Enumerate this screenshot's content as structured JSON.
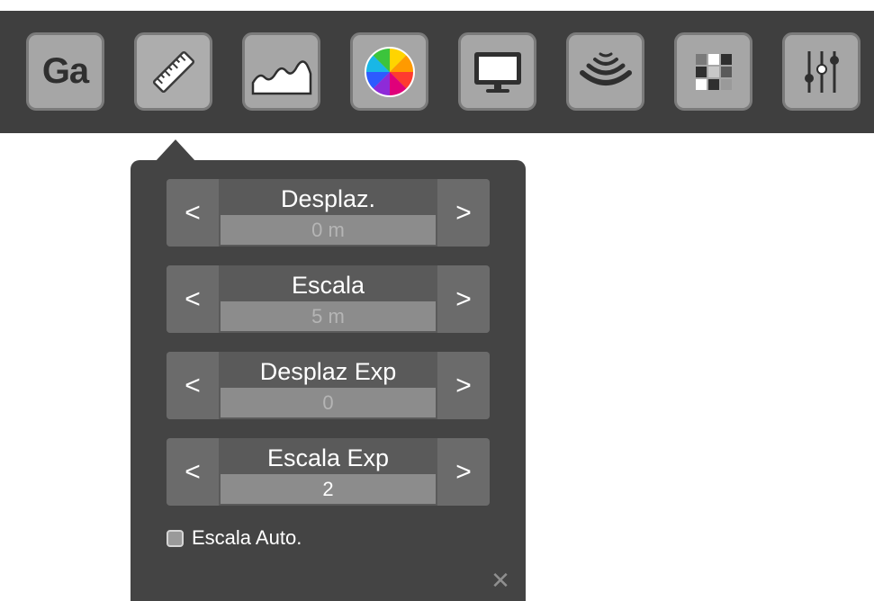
{
  "toolbar": {
    "buttons": [
      {
        "id": "gain",
        "icon": "gain-text-icon",
        "text": "Ga"
      },
      {
        "id": "ruler",
        "icon": "ruler-icon",
        "active": true
      },
      {
        "id": "profile",
        "icon": "profile-graph-icon"
      },
      {
        "id": "color",
        "icon": "color-wheel-icon"
      },
      {
        "id": "display",
        "icon": "monitor-icon"
      },
      {
        "id": "sonar",
        "icon": "sonar-waves-icon"
      },
      {
        "id": "palette",
        "icon": "grid-palette-icon"
      },
      {
        "id": "settings",
        "icon": "sliders-icon"
      }
    ]
  },
  "panel": {
    "steppers": [
      {
        "label": "Desplaz.",
        "value": "0 m"
      },
      {
        "label": "Escala",
        "value": "5 m"
      },
      {
        "label": "Desplaz Exp",
        "value": "0"
      },
      {
        "label": "Escala Exp",
        "value": "2"
      }
    ],
    "prev_glyph": "<",
    "next_glyph": ">",
    "auto_scale_label": "Escala Auto.",
    "auto_scale_checked": false,
    "close_glyph": "✕"
  },
  "colors": {
    "toolbar_bg": "#3f3f3f",
    "panel_bg": "#444444",
    "button_bg": "#a6a6a6"
  }
}
